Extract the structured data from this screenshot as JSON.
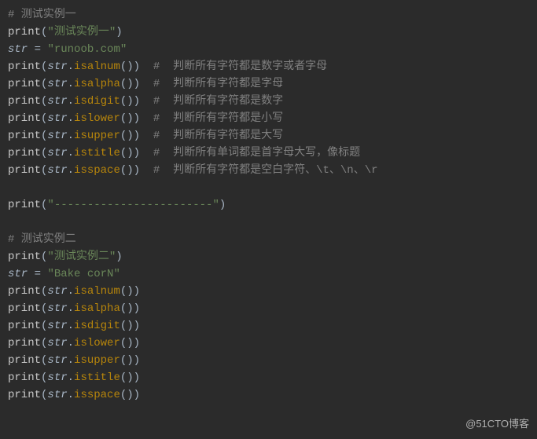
{
  "lines": [
    {
      "kind": "comment",
      "text": "# 测试实例一"
    },
    {
      "kind": "printstr",
      "value": "\"测试实例一\""
    },
    {
      "kind": "assign",
      "lhs": "str",
      "rhs": "\"runoob.com\""
    },
    {
      "kind": "printmethod",
      "obj": "str",
      "method": "isalnum",
      "comment": "#  判断所有字符都是数字或者字母"
    },
    {
      "kind": "printmethod",
      "obj": "str",
      "method": "isalpha",
      "comment": "#  判断所有字符都是字母"
    },
    {
      "kind": "printmethod",
      "obj": "str",
      "method": "isdigit",
      "comment": "#  判断所有字符都是数字"
    },
    {
      "kind": "printmethod",
      "obj": "str",
      "method": "islower",
      "comment": "#  判断所有字符都是小写"
    },
    {
      "kind": "printmethod",
      "obj": "str",
      "method": "isupper",
      "comment": "#  判断所有字符都是大写"
    },
    {
      "kind": "printmethod",
      "obj": "str",
      "method": "istitle",
      "comment": "#  判断所有单词都是首字母大写，像标题"
    },
    {
      "kind": "printmethod",
      "obj": "str",
      "method": "isspace",
      "comment": "#  判断所有字符都是空白字符、\\t、\\n、\\r"
    },
    {
      "kind": "blank"
    },
    {
      "kind": "printstr",
      "value": "\"------------------------\""
    },
    {
      "kind": "blank"
    },
    {
      "kind": "comment",
      "text": "# 测试实例二"
    },
    {
      "kind": "printstr",
      "value": "\"测试实例二\""
    },
    {
      "kind": "assign",
      "lhs": "str",
      "rhs": "\"Bake corN\""
    },
    {
      "kind": "printmethod",
      "obj": "str",
      "method": "isalnum"
    },
    {
      "kind": "printmethod",
      "obj": "str",
      "method": "isalpha"
    },
    {
      "kind": "printmethod",
      "obj": "str",
      "method": "isdigit"
    },
    {
      "kind": "printmethod",
      "obj": "str",
      "method": "islower"
    },
    {
      "kind": "printmethod",
      "obj": "str",
      "method": "isupper"
    },
    {
      "kind": "printmethod",
      "obj": "str",
      "method": "istitle"
    },
    {
      "kind": "printmethod",
      "obj": "str",
      "method": "isspace"
    }
  ],
  "fn_print": "print",
  "watermark": "@51CTO博客"
}
